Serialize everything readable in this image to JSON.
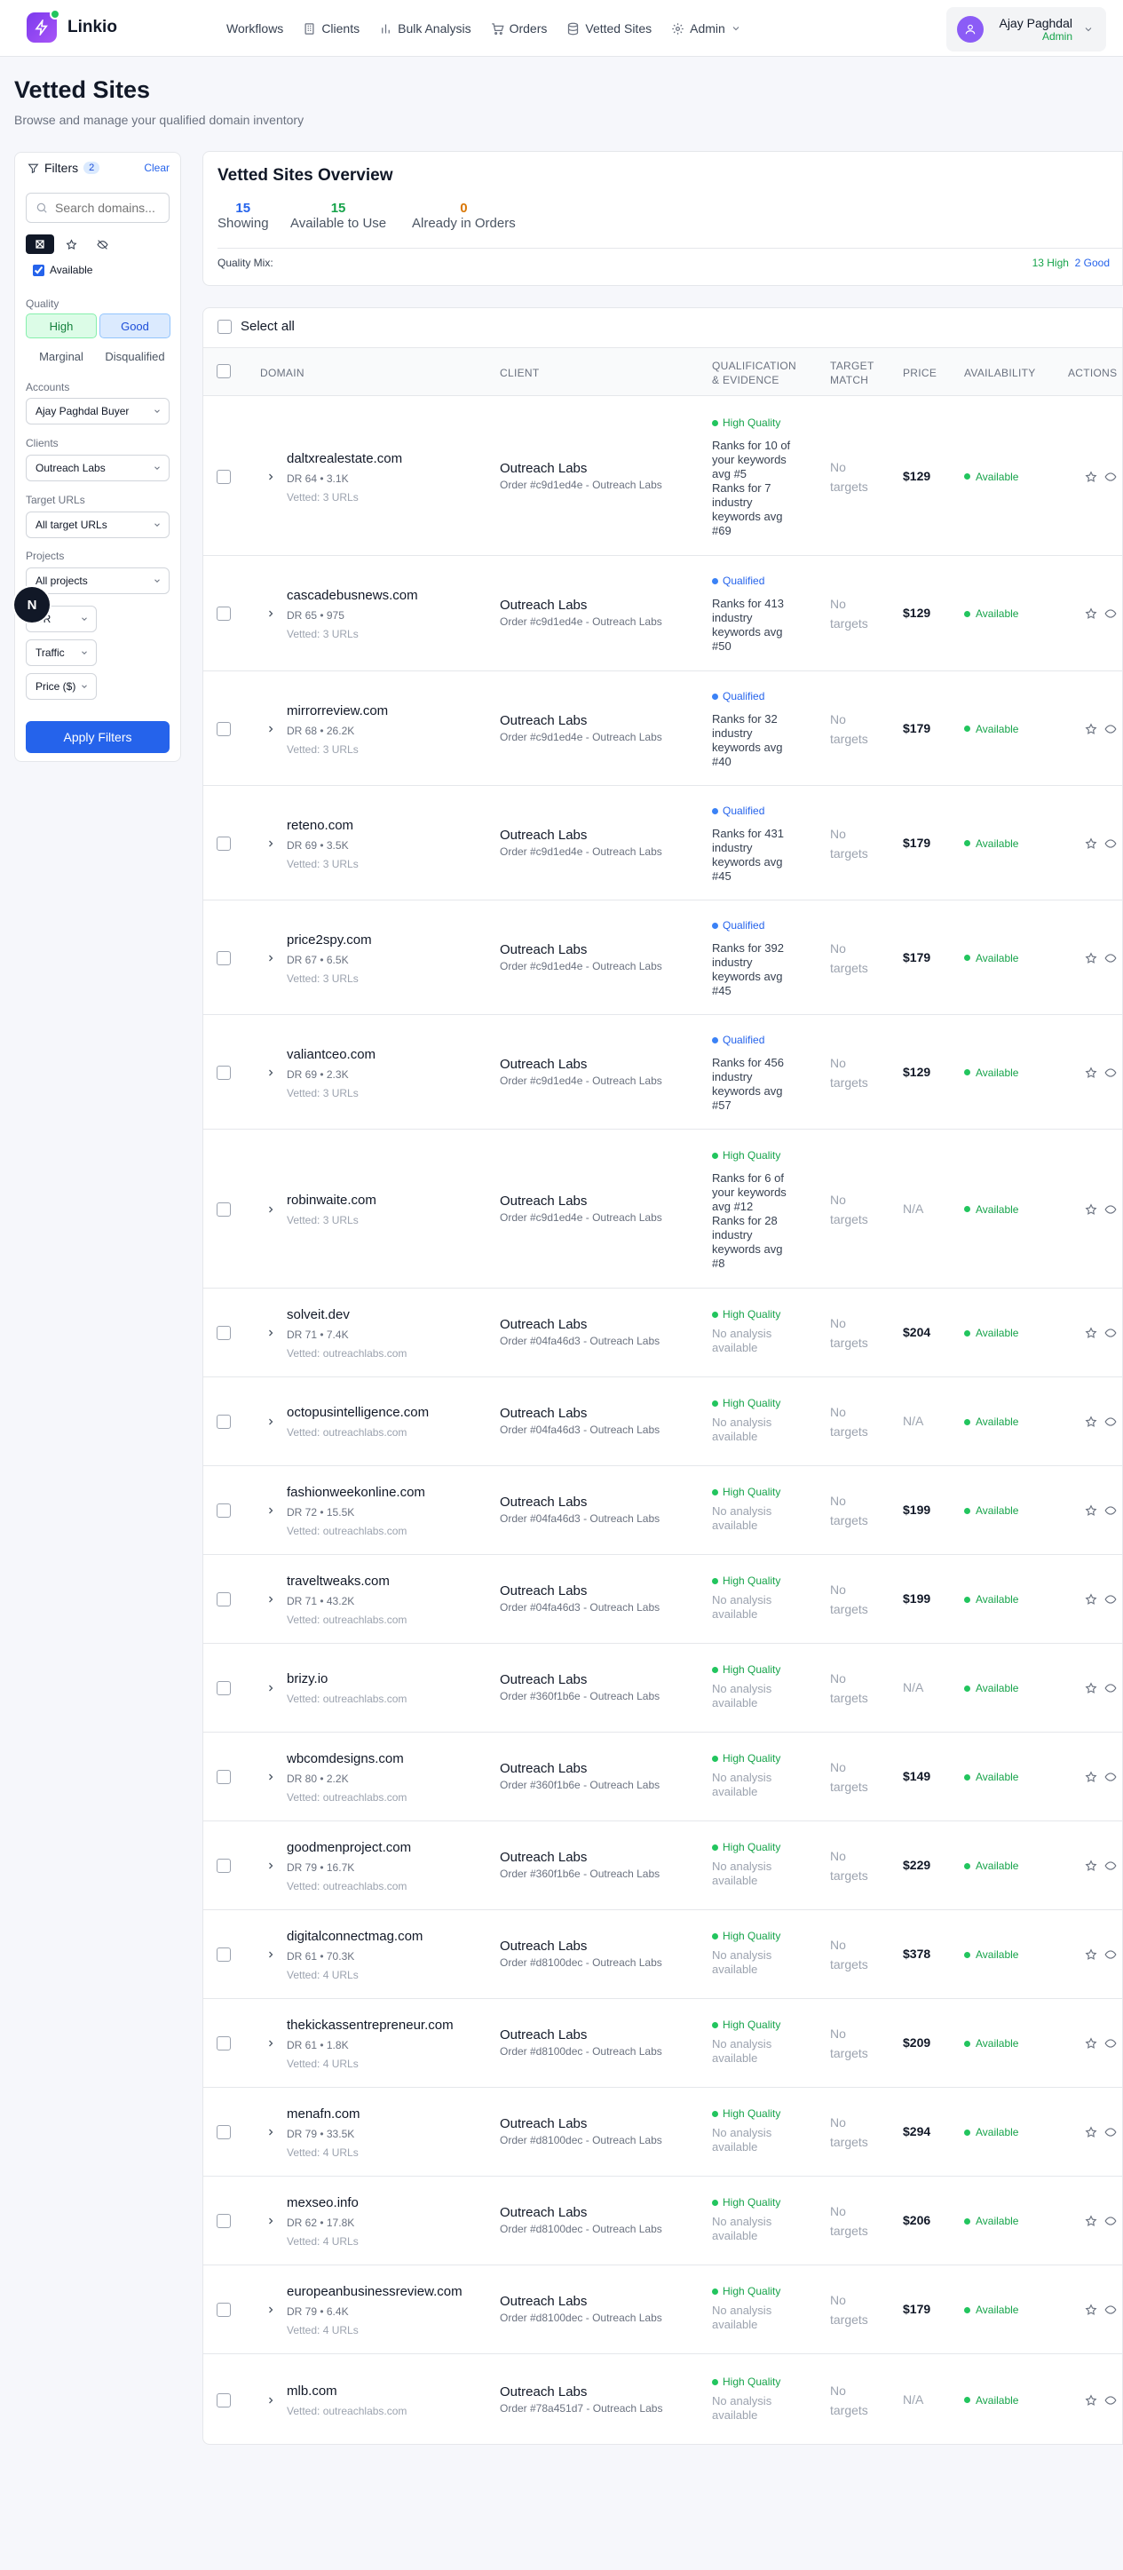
{
  "header": {
    "brand": "Linkio",
    "nav": [
      {
        "label": "Workflows",
        "icon": ""
      },
      {
        "label": "Clients",
        "icon": "building-icon"
      },
      {
        "label": "Bulk Analysis",
        "icon": "bar-chart-icon"
      },
      {
        "label": "Orders",
        "icon": "cart-icon"
      },
      {
        "label": "Vetted Sites",
        "icon": "database-icon"
      },
      {
        "label": "Admin",
        "icon": "gear-icon"
      }
    ],
    "user": {
      "name": "Ajay Paghdal",
      "role": "Admin"
    }
  },
  "page": {
    "title": "Vetted Sites",
    "subtitle": "Browse and manage your qualified domain inventory"
  },
  "filters": {
    "title": "Filters",
    "count": "2",
    "clear": "Clear",
    "search_placeholder": "Search domains...",
    "available_label": "Available",
    "quality_label": "Quality",
    "quality": {
      "high": "High",
      "good": "Good",
      "marginal": "Marginal",
      "disqualified": "Disqualified"
    },
    "accounts_label": "Accounts",
    "accounts_value": "Ajay Paghdal Buyer",
    "clients_label": "Clients",
    "clients_value": "Outreach Labs",
    "target_label": "Target URLs",
    "target_value": "All target URLs",
    "projects_label": "Projects",
    "projects_value": "All projects",
    "dr_value": "DR",
    "traffic_value": "Traffic",
    "price_value": "Price ($)",
    "apply": "Apply Filters",
    "n_badge": "N"
  },
  "overview": {
    "title": "Vetted Sites Overview",
    "showing_num": "15",
    "showing_label": "Showing",
    "available_num": "15",
    "available_label": "Available to Use",
    "orders_num": "0",
    "orders_label": "Already in Orders",
    "mix_label": "Quality Mix:",
    "mix_high": "13 High",
    "mix_good": "2 Good"
  },
  "table": {
    "select_all": "Select all",
    "columns": {
      "domain": "Domain",
      "client": "Client",
      "qual1": "Qualification",
      "qual2": "& Evidence",
      "target1": "Target",
      "target2": "Match",
      "price": "Price",
      "availability": "Availability",
      "actions": "Actions"
    },
    "rows": [
      {
        "domain": "daltxrealestate.com",
        "meta": "DR 64 • 3.1K",
        "vetted": "Vetted: 3 URLs",
        "client": "Outreach Labs",
        "order": "Order #c9d1ed4e - Outreach Labs",
        "quality": "High Quality",
        "qtype": "high",
        "evidence": [
          "Ranks for 10 of",
          "your keywords",
          "avg #5",
          "Ranks for 7",
          "industry",
          "keywords avg",
          "#69"
        ],
        "target1": "No",
        "target2": "targets",
        "price": "$129",
        "availability": "Available"
      },
      {
        "domain": "cascadebusnews.com",
        "meta": "DR 65 • 975",
        "vetted": "Vetted: 3 URLs",
        "client": "Outreach Labs",
        "order": "Order #c9d1ed4e - Outreach Labs",
        "quality": "Qualified",
        "qtype": "good",
        "evidence": [
          "Ranks for 413",
          "industry",
          "keywords avg",
          "#50"
        ],
        "target1": "No",
        "target2": "targets",
        "price": "$129",
        "availability": "Available"
      },
      {
        "domain": "mirrorreview.com",
        "meta": "DR 68 • 26.2K",
        "vetted": "Vetted: 3 URLs",
        "client": "Outreach Labs",
        "order": "Order #c9d1ed4e - Outreach Labs",
        "quality": "Qualified",
        "qtype": "good",
        "evidence": [
          "Ranks for 32",
          "industry",
          "keywords avg",
          "#40"
        ],
        "target1": "No",
        "target2": "targets",
        "price": "$179",
        "availability": "Available"
      },
      {
        "domain": "reteno.com",
        "meta": "DR 69 • 3.5K",
        "vetted": "Vetted: 3 URLs",
        "client": "Outreach Labs",
        "order": "Order #c9d1ed4e - Outreach Labs",
        "quality": "Qualified",
        "qtype": "good",
        "evidence": [
          "Ranks for 431",
          "industry",
          "keywords avg",
          "#45"
        ],
        "target1": "No",
        "target2": "targets",
        "price": "$179",
        "availability": "Available"
      },
      {
        "domain": "price2spy.com",
        "meta": "DR 67 • 6.5K",
        "vetted": "Vetted: 3 URLs",
        "client": "Outreach Labs",
        "order": "Order #c9d1ed4e - Outreach Labs",
        "quality": "Qualified",
        "qtype": "good",
        "evidence": [
          "Ranks for 392",
          "industry",
          "keywords avg",
          "#45"
        ],
        "target1": "No",
        "target2": "targets",
        "price": "$179",
        "availability": "Available"
      },
      {
        "domain": "valiantceo.com",
        "meta": "DR 69 • 2.3K",
        "vetted": "Vetted: 3 URLs",
        "client": "Outreach Labs",
        "order": "Order #c9d1ed4e - Outreach Labs",
        "quality": "Qualified",
        "qtype": "good",
        "evidence": [
          "Ranks for 456",
          "industry",
          "keywords avg",
          "#57"
        ],
        "target1": "No",
        "target2": "targets",
        "price": "$129",
        "availability": "Available"
      },
      {
        "domain": "robinwaite.com",
        "meta": "",
        "vetted": "Vetted: 3 URLs",
        "client": "Outreach Labs",
        "order": "Order #c9d1ed4e - Outreach Labs",
        "quality": "High Quality",
        "qtype": "high",
        "evidence": [
          "Ranks for 6 of",
          "your keywords",
          "avg #12",
          "Ranks for 28",
          "industry",
          "keywords avg",
          "#8"
        ],
        "target1": "No",
        "target2": "targets",
        "price": "N/A",
        "availability": "Available"
      },
      {
        "domain": "solveit.dev",
        "meta": "DR 71 • 7.4K",
        "vetted": "Vetted: outreachlabs.com",
        "client": "Outreach Labs",
        "order": "Order #04fa46d3 - Outreach Labs",
        "quality": "High Quality",
        "qtype": "high",
        "evidence": [
          "No analysis",
          "available"
        ],
        "target1": "No",
        "target2": "targets",
        "price": "$204",
        "availability": "Available"
      },
      {
        "domain": "octopusintelligence.com",
        "meta": "",
        "vetted": "Vetted: outreachlabs.com",
        "client": "Outreach Labs",
        "order": "Order #04fa46d3 - Outreach Labs",
        "quality": "High Quality",
        "qtype": "high",
        "evidence": [
          "No analysis",
          "available"
        ],
        "target1": "No",
        "target2": "targets",
        "price": "N/A",
        "availability": "Available"
      },
      {
        "domain": "fashionweekonline.com",
        "meta": "DR 72 • 15.5K",
        "vetted": "Vetted: outreachlabs.com",
        "client": "Outreach Labs",
        "order": "Order #04fa46d3 - Outreach Labs",
        "quality": "High Quality",
        "qtype": "high",
        "evidence": [
          "No analysis",
          "available"
        ],
        "target1": "No",
        "target2": "targets",
        "price": "$199",
        "availability": "Available"
      },
      {
        "domain": "traveltweaks.com",
        "meta": "DR 71 • 43.2K",
        "vetted": "Vetted: outreachlabs.com",
        "client": "Outreach Labs",
        "order": "Order #04fa46d3 - Outreach Labs",
        "quality": "High Quality",
        "qtype": "high",
        "evidence": [
          "No analysis",
          "available"
        ],
        "target1": "No",
        "target2": "targets",
        "price": "$199",
        "availability": "Available"
      },
      {
        "domain": "brizy.io",
        "meta": "",
        "vetted": "Vetted: outreachlabs.com",
        "client": "Outreach Labs",
        "order": "Order #360f1b6e - Outreach Labs",
        "quality": "High Quality",
        "qtype": "high",
        "evidence": [
          "No analysis",
          "available"
        ],
        "target1": "No",
        "target2": "targets",
        "price": "N/A",
        "availability": "Available"
      },
      {
        "domain": "wbcomdesigns.com",
        "meta": "DR 80 • 2.2K",
        "vetted": "Vetted: outreachlabs.com",
        "client": "Outreach Labs",
        "order": "Order #360f1b6e - Outreach Labs",
        "quality": "High Quality",
        "qtype": "high",
        "evidence": [
          "No analysis",
          "available"
        ],
        "target1": "No",
        "target2": "targets",
        "price": "$149",
        "availability": "Available"
      },
      {
        "domain": "goodmenproject.com",
        "meta": "DR 79 • 16.7K",
        "vetted": "Vetted: outreachlabs.com",
        "client": "Outreach Labs",
        "order": "Order #360f1b6e - Outreach Labs",
        "quality": "High Quality",
        "qtype": "high",
        "evidence": [
          "No analysis",
          "available"
        ],
        "target1": "No",
        "target2": "targets",
        "price": "$229",
        "availability": "Available"
      },
      {
        "domain": "digitalconnectmag.com",
        "meta": "DR 61 • 70.3K",
        "vetted": "Vetted: 4 URLs",
        "client": "Outreach Labs",
        "order": "Order #d8100dec - Outreach Labs",
        "quality": "High Quality",
        "qtype": "high",
        "evidence": [
          "No analysis",
          "available"
        ],
        "target1": "No",
        "target2": "targets",
        "price": "$378",
        "availability": "Available"
      },
      {
        "domain": "thekickassentrepreneur.com",
        "meta": "DR 61 • 1.8K",
        "vetted": "Vetted: 4 URLs",
        "client": "Outreach Labs",
        "order": "Order #d8100dec - Outreach Labs",
        "quality": "High Quality",
        "qtype": "high",
        "evidence": [
          "No analysis",
          "available"
        ],
        "target1": "No",
        "target2": "targets",
        "price": "$209",
        "availability": "Available"
      },
      {
        "domain": "menafn.com",
        "meta": "DR 79 • 33.5K",
        "vetted": "Vetted: 4 URLs",
        "client": "Outreach Labs",
        "order": "Order #d8100dec - Outreach Labs",
        "quality": "High Quality",
        "qtype": "high",
        "evidence": [
          "No analysis",
          "available"
        ],
        "target1": "No",
        "target2": "targets",
        "price": "$294",
        "availability": "Available"
      },
      {
        "domain": "mexseo.info",
        "meta": "DR 62 • 17.8K",
        "vetted": "Vetted: 4 URLs",
        "client": "Outreach Labs",
        "order": "Order #d8100dec - Outreach Labs",
        "quality": "High Quality",
        "qtype": "high",
        "evidence": [
          "No analysis",
          "available"
        ],
        "target1": "No",
        "target2": "targets",
        "price": "$206",
        "availability": "Available"
      },
      {
        "domain": "europeanbusinessreview.com",
        "meta": "DR 79 • 6.4K",
        "vetted": "Vetted: 4 URLs",
        "client": "Outreach Labs",
        "order": "Order #d8100dec - Outreach Labs",
        "quality": "High Quality",
        "qtype": "high",
        "evidence": [
          "No analysis",
          "available"
        ],
        "target1": "No",
        "target2": "targets",
        "price": "$179",
        "availability": "Available"
      },
      {
        "domain": "mlb.com",
        "meta": "",
        "vetted": "Vetted: outreachlabs.com",
        "client": "Outreach Labs",
        "order": "Order #78a451d7 - Outreach Labs",
        "quality": "High Quality",
        "qtype": "high",
        "evidence": [
          "No analysis",
          "available"
        ],
        "target1": "No",
        "target2": "targets",
        "price": "N/A",
        "availability": "Available"
      }
    ]
  },
  "colors": {
    "primary": "#2563eb",
    "high": "#16a34a",
    "brand": "#7c3aed"
  }
}
